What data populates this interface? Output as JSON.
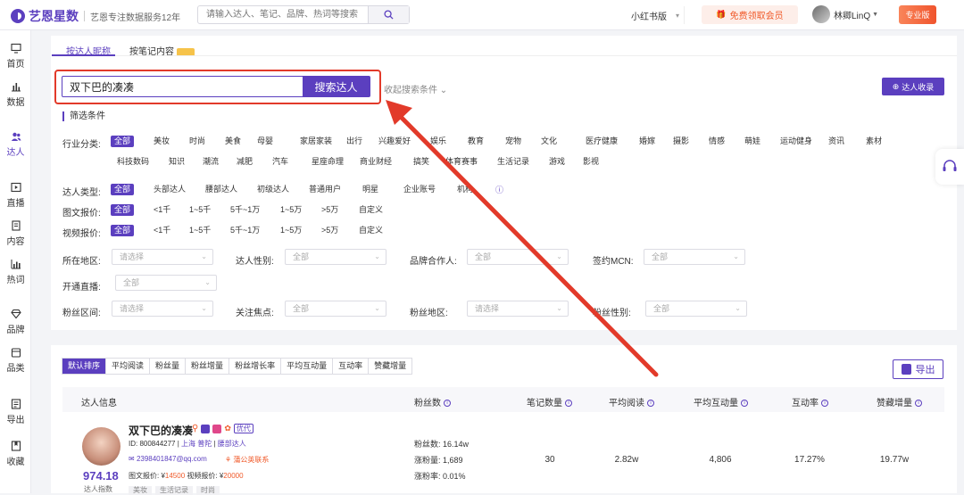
{
  "header": {
    "brand": "艺恩星数",
    "slogan": "艺恩专注数据服务12年",
    "search_placeholder": "请输入达人、笔记、品牌、热词等搜索",
    "platform": "小红书版",
    "member_label": "免费领取会员",
    "user_name": "林卿LinQ",
    "pro_label": "专业版"
  },
  "sidebar": {
    "items": [
      {
        "label": "首页",
        "icon": "monitor-icon"
      },
      {
        "label": "数据",
        "icon": "bar-chart-icon"
      },
      {
        "label": "达人",
        "icon": "people-icon"
      },
      {
        "label": "直播",
        "icon": "play-icon"
      },
      {
        "label": "内容",
        "icon": "document-icon"
      },
      {
        "label": "热词",
        "icon": "chart-icon"
      },
      {
        "label": "品牌",
        "icon": "diamond-icon"
      },
      {
        "label": "品类",
        "icon": "box-icon"
      },
      {
        "label": "导出",
        "icon": "export-icon"
      },
      {
        "label": "收藏",
        "icon": "bookmark-icon"
      }
    ]
  },
  "tabs": [
    {
      "label": "按达人昵称"
    },
    {
      "label": "按笔记内容"
    }
  ],
  "search": {
    "value": "双下巴的凑凑",
    "button_label": "搜索达人",
    "collapse_label": "收起搜索条件",
    "collect_label": "达人收录"
  },
  "filters": {
    "title": "筛选条件",
    "industry_label": "行业分类:",
    "industry_row1": [
      "全部",
      "美妆",
      "时尚",
      "美食",
      "母婴",
      "家居家装",
      "出行",
      "兴趣爱好",
      "娱乐",
      "教育",
      "宠物",
      "文化",
      "医疗健康",
      "婚嫁",
      "摄影",
      "情感",
      "萌娃",
      "运动健身",
      "资讯",
      "素材"
    ],
    "industry_row2": [
      "科技数码",
      "知识",
      "潮流",
      "减肥",
      "汽车",
      "星座命理",
      "商业财经",
      "搞笑",
      "体育赛事",
      "生活记录",
      "游戏",
      "影视"
    ],
    "type_label": "达人类型:",
    "types": [
      "全部",
      "头部达人",
      "腰部达人",
      "初级达人",
      "普通用户",
      "明星",
      "企业账号",
      "机构"
    ],
    "image_price_label": "图文报价:",
    "video_price_label": "视频报价:",
    "prices": [
      "全部",
      "<1千",
      "1~5千",
      "5千~1万",
      "1~5万",
      ">5万",
      "自定义"
    ],
    "selects": [
      {
        "label": "所在地区:",
        "placeholder": "请选择"
      },
      {
        "label": "达人性别:",
        "placeholder": "全部"
      },
      {
        "label": "品牌合作人:",
        "placeholder": "全部"
      },
      {
        "label": "签约MCN:",
        "placeholder": "全部"
      },
      {
        "label": "开通直播:",
        "placeholder": "全部"
      },
      {
        "label": "粉丝区间:",
        "placeholder": "请选择"
      },
      {
        "label": "关注焦点:",
        "placeholder": "全部"
      },
      {
        "label": "粉丝地区:",
        "placeholder": "请选择"
      },
      {
        "label": "粉丝性别:",
        "placeholder": "全部"
      }
    ]
  },
  "sort_tabs": [
    "默认排序",
    "平均阅读",
    "粉丝量",
    "粉丝增量",
    "粉丝增长率",
    "平均互动量",
    "互动率",
    "赞藏增量"
  ],
  "export_label": "导出",
  "table": {
    "headers": [
      "达人信息",
      "粉丝数",
      "笔记数量",
      "平均阅读",
      "平均互动量",
      "互动率",
      "赞藏增量"
    ],
    "row": {
      "name": "双下巴的凑凑",
      "tag": "优代",
      "id_text": "ID: 800844277",
      "location": "上海 普陀",
      "level": "腰部达人",
      "email": "2398401847@qq.com",
      "mcn": "蒲公英联系",
      "price_text": "图文报价: ¥",
      "image_price": "14500",
      "video_price_text": "视频报价: ¥",
      "video_price": "20000",
      "score": "974.18",
      "score_label": "达人指数",
      "fans": "粉丝数: 16.14w",
      "fans_growth": "涨粉量: 1,689",
      "fans_rate": "涨粉率: 0.01%",
      "notes": "30",
      "avg_read": "2.82w",
      "avg_interact": "4,806",
      "interact_rate": "17.27%",
      "like_growth": "19.77w",
      "cats": [
        "美妆",
        "生活记录",
        "时尚"
      ]
    }
  },
  "colors": {
    "accent": "#5b3fbf",
    "highlight": "#e23a2a",
    "orange": "#f05a2a"
  }
}
